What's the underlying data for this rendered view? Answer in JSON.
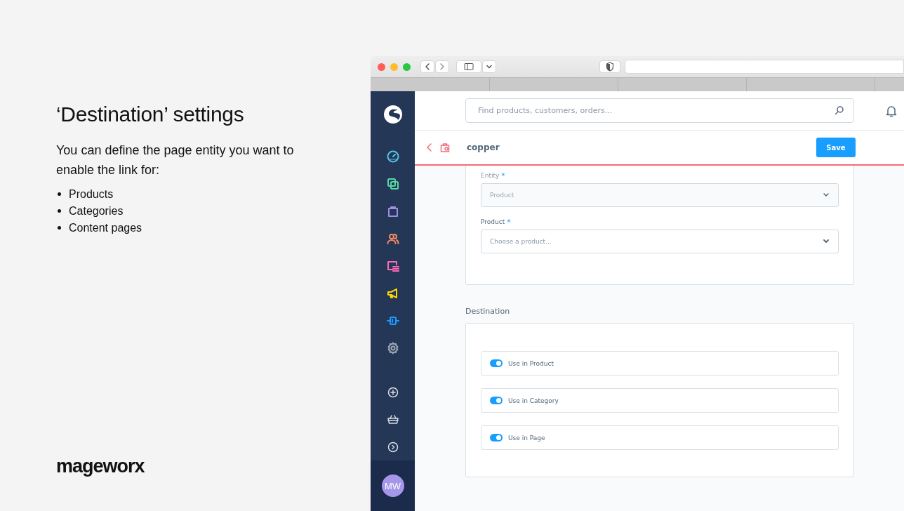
{
  "slide": {
    "title": "‘Destination’ settings",
    "intro": "You can define the page entity you want to enable the link for:",
    "bullets": [
      "Products",
      "Categories",
      "Content pages"
    ],
    "logo": "mageworx"
  },
  "app": {
    "search": {
      "placeholder": "Find products, customers, orders..."
    },
    "sidebar": {
      "items": [
        {
          "kind": "dashboard",
          "color": "#57c4e4"
        },
        {
          "kind": "catalog",
          "color": "#57d9a3"
        },
        {
          "kind": "orders",
          "color": "#9f8de8"
        },
        {
          "kind": "customers",
          "color": "#f88962"
        },
        {
          "kind": "content",
          "color": "#ff68b4"
        },
        {
          "kind": "marketing",
          "color": "#ffd700"
        },
        {
          "kind": "extensions",
          "color": "#189eff"
        },
        {
          "kind": "settings",
          "color": "#a0abb8"
        }
      ],
      "footer_items": [
        {
          "kind": "add"
        },
        {
          "kind": "basket"
        },
        {
          "kind": "expand"
        }
      ],
      "avatar": "MW"
    },
    "page_title": "copper",
    "save_button": "Save",
    "entity": {
      "label": "Entity",
      "required_mark": "*",
      "value": "Product",
      "disabled": true
    },
    "product": {
      "label": "Product",
      "required_mark": "*",
      "placeholder": "Choose a product..."
    },
    "destination": {
      "title": "Destination",
      "toggles": [
        {
          "label": "Use in Product",
          "on": true
        },
        {
          "label": "Use in Category",
          "on": true
        },
        {
          "label": "Use in Page",
          "on": true
        }
      ]
    }
  }
}
